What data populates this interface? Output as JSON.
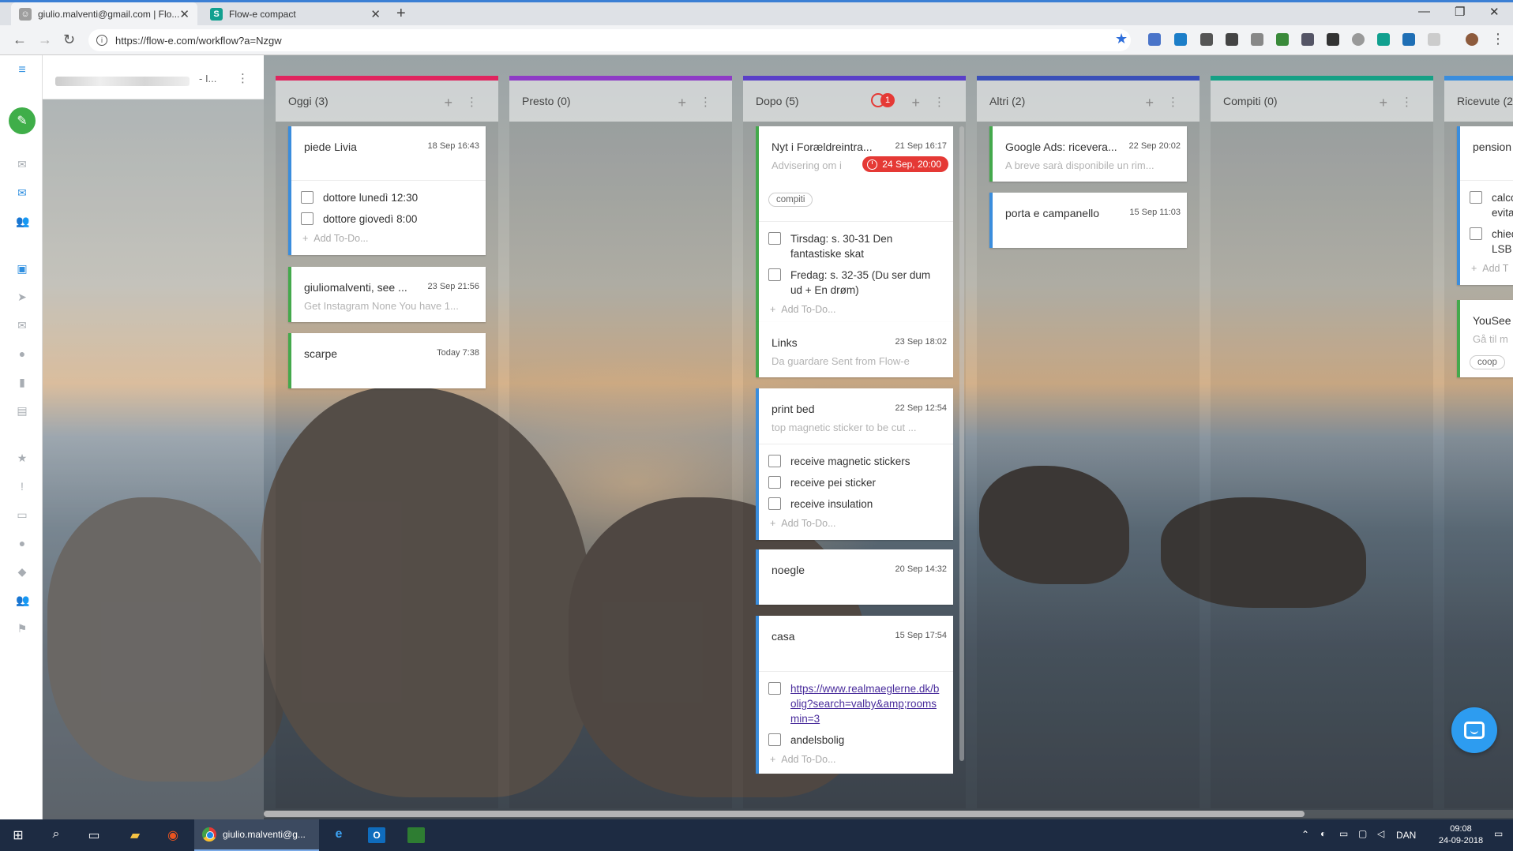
{
  "browser": {
    "tabs": [
      {
        "title": "giulio.malventi@gmail.com | Flo..."
      },
      {
        "title": "Flow-e compact"
      }
    ],
    "url": "https://flow-e.com/workflow?a=Nzgw"
  },
  "app": {
    "account_suffix": "- I...",
    "columns": [
      {
        "name": "Oggi",
        "count": "(3)",
        "color": "#e0245e",
        "cards": [
          {
            "title": "piede Livia",
            "date": "18 Sep 16:43",
            "todos": [
              "dottore lunedì 12:30",
              "dottore giovedì 8:00"
            ],
            "add_todo": "Add To-Do..."
          },
          {
            "title": "giuliomalventi, see ...",
            "date": "23 Sep 21:56",
            "subtitle": "Get Instagram None You have 1..."
          },
          {
            "title": "scarpe",
            "date": "Today 7:38"
          }
        ]
      },
      {
        "name": "Presto",
        "count": "(0)",
        "color": "#8e3bc6",
        "cards": []
      },
      {
        "name": "Dopo",
        "count": "(5)",
        "color": "#5a3fc8",
        "alarm_count": "1",
        "cards": [
          {
            "title": "Nyt i Forældreintra...",
            "date": "21 Sep 16:17",
            "subtitle": "Advisering om i",
            "reminder": "24 Sep, 20:00",
            "tag": "compiti",
            "todos": [
              "Tirsdag: s. 30-31 Den fantastiske skat",
              "Fredag: s. 32-35 (Du ser dum ud + En drøm)"
            ],
            "add_todo": "Add To-Do..."
          },
          {
            "title": "Links",
            "date": "23 Sep 18:02",
            "subtitle": "Da guardare Sent from Flow-e"
          },
          {
            "title": "print bed",
            "date": "22 Sep 12:54",
            "subtitle": "top magnetic sticker to be cut ...",
            "todos": [
              "receive magnetic stickers",
              "receive pei sticker",
              "receive insulation"
            ],
            "add_todo": "Add To-Do..."
          },
          {
            "title": "noegle",
            "date": "20 Sep 14:32"
          },
          {
            "title": "casa",
            "date": "15 Sep 17:54",
            "link_todo": "https://www.realmaeglerne.dk/bolig?search=valby&amp;roomsmin=3",
            "todos": [
              "andelsbolig"
            ],
            "add_todo": "Add To-Do..."
          }
        ]
      },
      {
        "name": "Altri",
        "count": "(2)",
        "color": "#3a4fb8",
        "cards": [
          {
            "title": "Google Ads: ricevera...",
            "date": "22 Sep 20:02",
            "subtitle": "A breve sarà disponibile un rim..."
          },
          {
            "title": "porta e campanello",
            "date": "15 Sep 11:03"
          }
        ]
      },
      {
        "name": "Compiti",
        "count": "(0)",
        "color": "#16a085",
        "cards": []
      },
      {
        "name": "Ricevute",
        "count": "(2",
        "color": "#3a8ddd",
        "cards": [
          {
            "title": "pension",
            "todos": [
              "calco evita",
              "chiec LSB"
            ],
            "add_todo": "Add T"
          },
          {
            "title": "YouSee",
            "subtitle": "Gå til m",
            "tag": "coop"
          }
        ]
      }
    ]
  },
  "taskbar": {
    "chrome_label": "giulio.malventi@g...",
    "lang": "DAN",
    "time": "09:08",
    "date": "24-09-2018"
  }
}
